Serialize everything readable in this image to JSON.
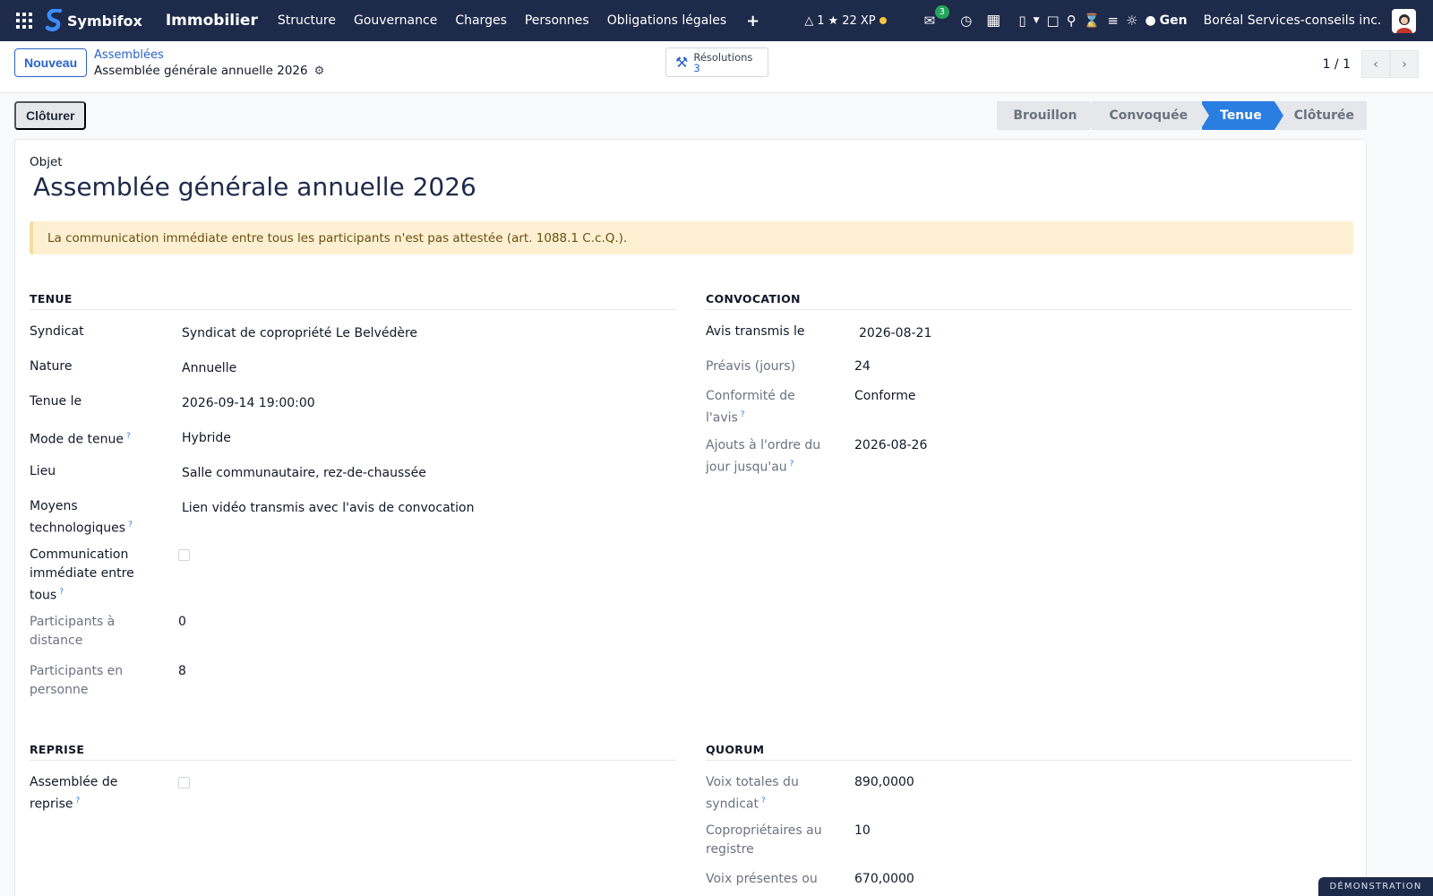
{
  "navbar": {
    "brand": "Symbifox",
    "module": "Immobilier",
    "menu": [
      "Structure",
      "Gouvernance",
      "Charges",
      "Personnes",
      "Obligations légales"
    ],
    "plus": "+",
    "streak": "1",
    "xp": "22 XP",
    "messages_badge": "3",
    "gen": "Gen",
    "company": "Boréal Services-conseils inc."
  },
  "control": {
    "new_label": "Nouveau",
    "breadcrumb_parent": "Assemblées",
    "breadcrumb_current": "Assemblée générale annuelle 2026",
    "smart_button": {
      "label": "Résolutions",
      "count": "3"
    },
    "pager": "1 / 1"
  },
  "status": {
    "close_label": "Clôturer",
    "stages": [
      "Brouillon",
      "Convoquée",
      "Tenue",
      "Clôturée"
    ],
    "active_stage": "Tenue"
  },
  "form": {
    "object_label": "Objet",
    "title": "Assemblée générale annuelle 2026",
    "alert": "La communication immédiate entre tous les participants n'est pas attestée (art. 1088.1 C.c.Q.).",
    "tenue": {
      "title": "TENUE",
      "syndicat_label": "Syndicat",
      "syndicat": "Syndicat de copropriété Le Belvédère",
      "nature_label": "Nature",
      "nature": "Annuelle",
      "tenue_le_label": "Tenue le",
      "tenue_le": "2026-09-14 19:00:00",
      "mode_label": "Mode de tenue",
      "mode": "Hybride",
      "lieu_label": "Lieu",
      "lieu": "Salle communautaire, rez-de-chaussée",
      "moyens_label_1": "Moyens",
      "moyens_label_2": "technologiques",
      "moyens": "Lien vidéo transmis avec l'avis de convocation",
      "comm_label_1": "Communication",
      "comm_label_2": "immédiate entre",
      "comm_label_3": "tous",
      "distance_label_1": "Participants à",
      "distance_label_2": "distance",
      "distance": "0",
      "personne_label_1": "Participants en",
      "personne_label_2": "personne",
      "personne": "8"
    },
    "convocation": {
      "title": "CONVOCATION",
      "avis_label": "Avis transmis le",
      "avis": "2026-08-21",
      "preavis_label": "Préavis (jours)",
      "preavis": "24",
      "conformite_label_1": "Conformité de",
      "conformite_label_2": "l'avis",
      "conformite": "Conforme",
      "ajouts_label_1": "Ajouts à l'ordre du",
      "ajouts_label_2": "jour jusqu'au",
      "ajouts": "2026-08-26"
    },
    "reprise": {
      "title": "REPRISE",
      "label_1": "Assemblée de",
      "label_2": "reprise"
    },
    "quorum": {
      "title": "QUORUM",
      "voix_label_1": "Voix totales du",
      "voix_label_2": "syndicat",
      "voix": "890,0000",
      "copro_label_1": "Copropriétaires au",
      "copro_label_2": "registre",
      "copro": "10",
      "presentes_label": "Voix présentes ou",
      "presentes": "670,0000"
    },
    "help_mark": "?"
  },
  "demo": "DÉMONSTRATION"
}
